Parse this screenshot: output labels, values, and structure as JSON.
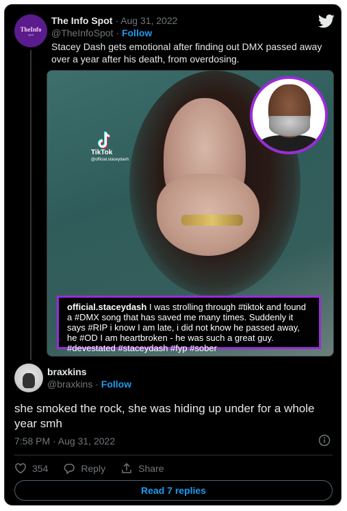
{
  "tweet": {
    "author_name": "The Info Spot",
    "separator": " · ",
    "date": "Aug 31, 2022",
    "handle": "@TheInfoSpot",
    "follow_label": "Follow",
    "avatar_logo_text": "TheInfo",
    "avatar_logo_sub": "spot",
    "text": "Stacey Dash gets emotional after finding out DMX passed away over a year after his death, from overdosing.",
    "media": {
      "tiktok_label": "TikTok",
      "tiktok_user": "@official.staceydash",
      "caption_user": "official.staceydash",
      "caption_text": " I was strolling through #tiktok and found a #DMX song that has saved me many times. Suddenly it says #RIP  i know I am late, i did not know he passed away, he #OD I am heartbroken - he was such a great guy. #devestated #staceydash #fyp #sober"
    }
  },
  "reply": {
    "author_name": "braxkins",
    "handle": "@braxkins",
    "separator": " · ",
    "follow_label": "Follow",
    "text": "she smoked the rock, she was hiding up under for a whole year smh",
    "timestamp": "7:58 PM · Aug 31, 2022",
    "like_count": "354",
    "reply_label": "Reply",
    "share_label": "Share",
    "read_replies_label": "Read 7 replies"
  },
  "colors": {
    "background": "#000000",
    "accent": "#1d9bf0",
    "muted": "#71767b",
    "caption_border": "#9b2bd8"
  },
  "icons": [
    "twitter-bird-icon",
    "tiktok-icon",
    "info-icon",
    "heart-icon",
    "reply-bubble-icon",
    "share-icon"
  ]
}
